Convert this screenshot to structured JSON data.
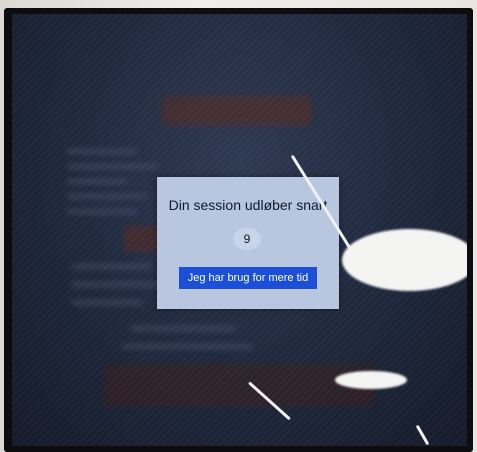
{
  "dialog": {
    "title": "Din session udløber snart",
    "countdown": "9",
    "more_time_label": "Jeg har brug for mere tid"
  },
  "colors": {
    "dialog_background": "#b8c6e0",
    "button_background": "#1c4fd8",
    "button_text": "#ffffff",
    "screen_background": "#202a40"
  },
  "icons": []
}
